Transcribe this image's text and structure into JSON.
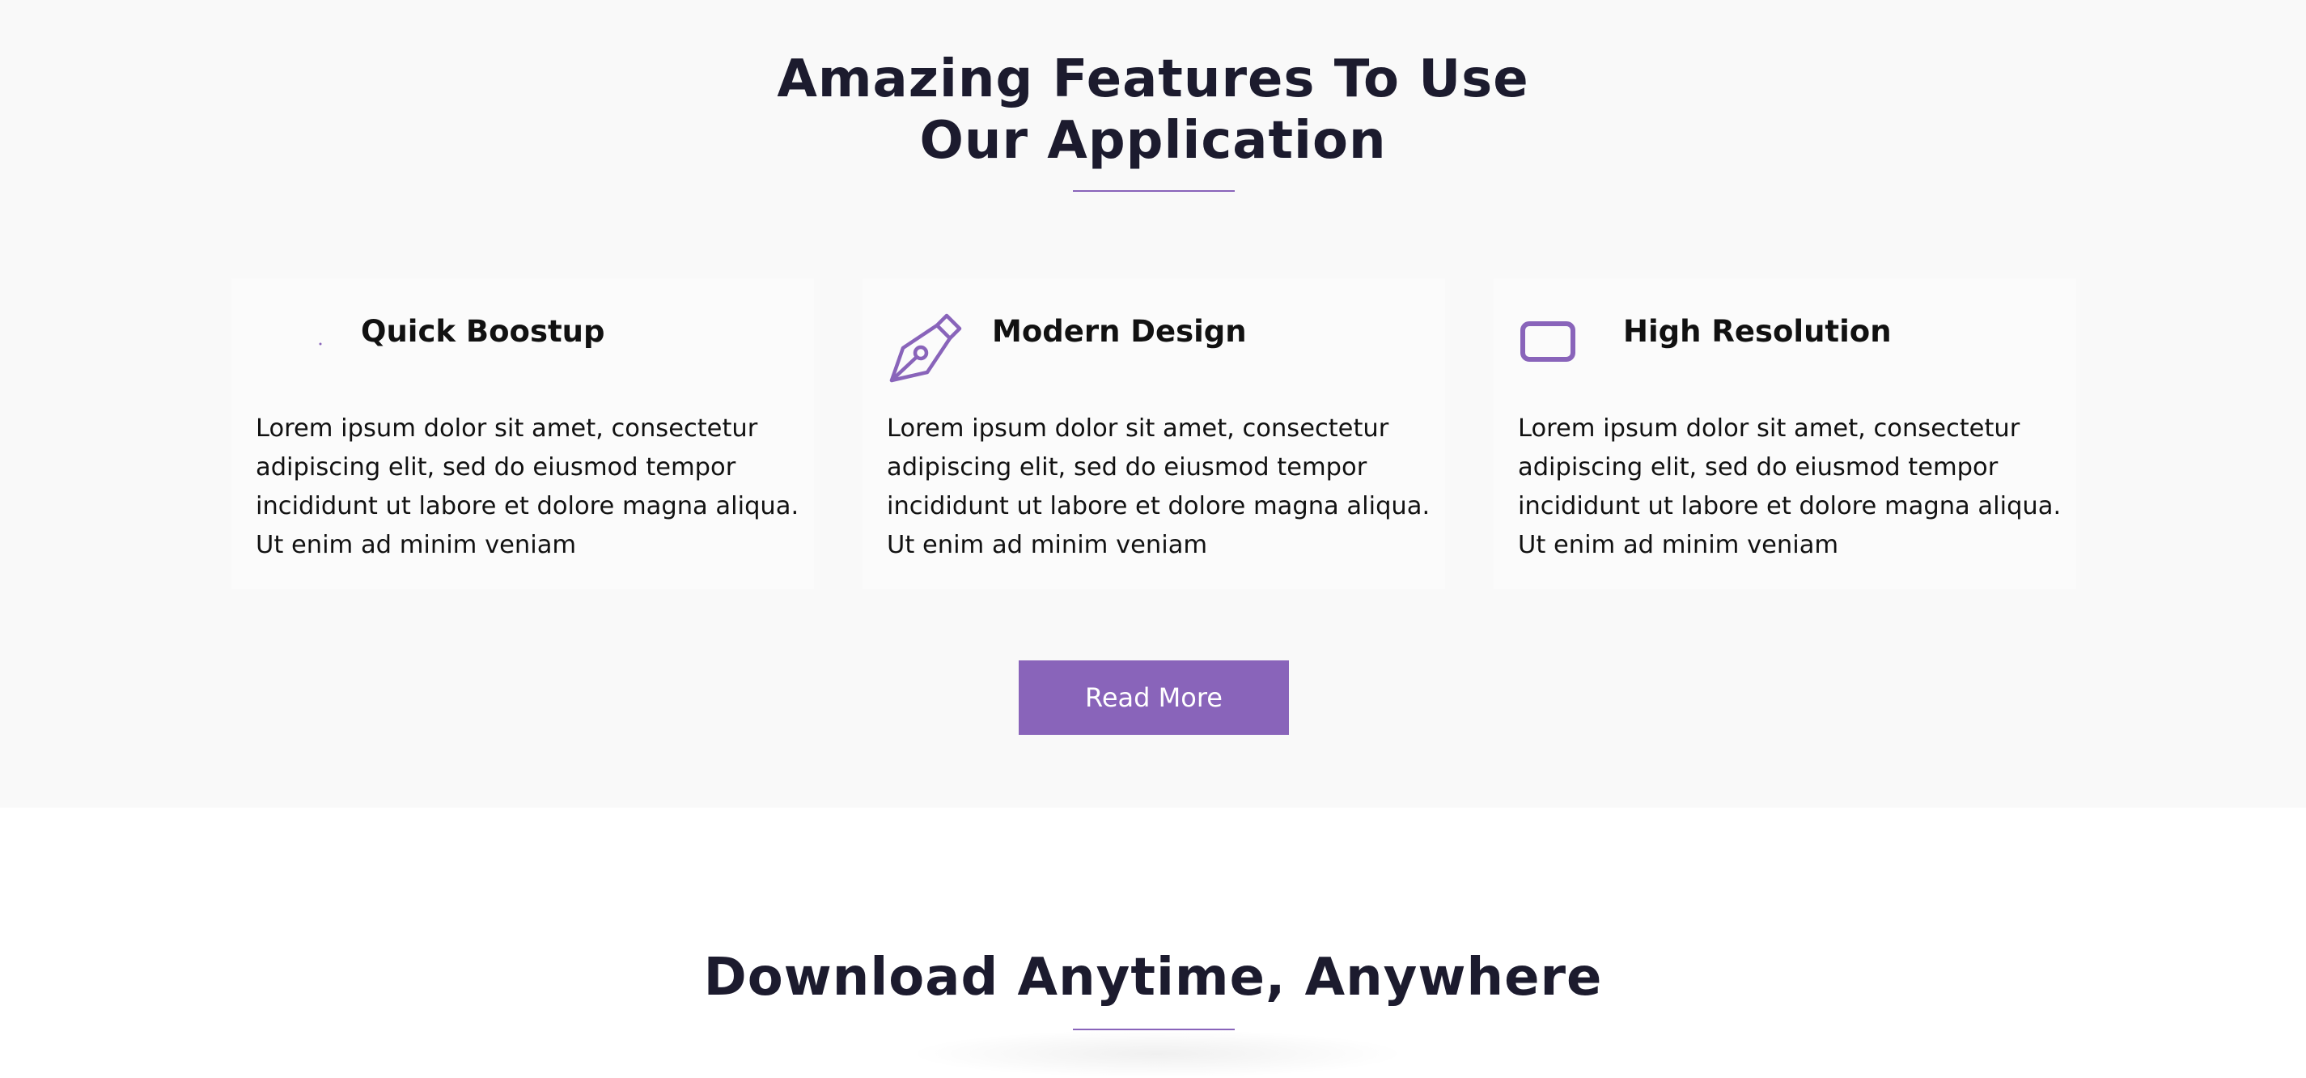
{
  "features": {
    "title_line1": "Amazing Features To Use",
    "title_line2": "Our Application",
    "cards": [
      {
        "icon": "rocket-icon",
        "title": "Quick Boostup",
        "text": "Lorem ipsum dolor sit amet, consectetur adipiscing elit, sed do eiusmod tempor incididunt ut labore et dolore magna aliqua. Ut enim ad minim veniam"
      },
      {
        "icon": "pen-nib-icon",
        "title": "Modern Design",
        "text": "Lorem ipsum dolor sit amet, consectetur adipiscing elit, sed do eiusmod tempor incididunt ut labore et dolore magna aliqua. Ut enim ad minim veniam"
      },
      {
        "icon": "screen-icon",
        "title": "High Resolution",
        "text": "Lorem ipsum dolor sit amet, consectetur adipiscing elit, sed do eiusmod tempor incididunt ut labore et dolore magna aliqua. Ut enim ad minim veniam"
      }
    ],
    "button_label": "Read More"
  },
  "download": {
    "title": "Download Anytime, Anywhere"
  },
  "colors": {
    "accent": "#8964ba",
    "heading": "#1c1b2e",
    "section_bg": "#f9f9f9"
  }
}
